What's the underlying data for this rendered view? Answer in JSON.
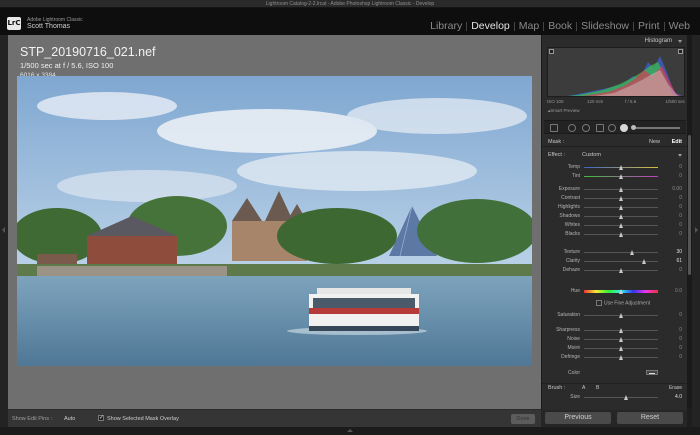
{
  "window": {
    "title": "Lightroom Catalog-2-2.lrcat - Adobe Photoshop Lightroom Classic - Develop"
  },
  "identity": {
    "logo": "LrC",
    "app_name": "Adobe Lightroom Classic",
    "user_name": "Scott Thomas"
  },
  "modules": [
    {
      "label": "Library",
      "active": false
    },
    {
      "label": "Develop",
      "active": true
    },
    {
      "label": "Map",
      "active": false
    },
    {
      "label": "Book",
      "active": false
    },
    {
      "label": "Slideshow",
      "active": false
    },
    {
      "label": "Print",
      "active": false
    },
    {
      "label": "Web",
      "active": false
    }
  ],
  "image_info": {
    "file_name": "STP_20190716_021.nef",
    "exif": "1/500 sec at f / 5.6, ISO 100",
    "dimensions": "6016 x 3384"
  },
  "toolbar": {
    "edit_pins_label": "Show Edit Pins :",
    "edit_pins_value": "Auto",
    "overlay_label": "Show Selected Mask Overlay",
    "done_label": "Done"
  },
  "histogram": {
    "label": "Histogram",
    "iso": "ISO 100",
    "focal": "120 mm",
    "aperture": "f / 5.6",
    "shutter": "1/500 sec",
    "smart_preview": "Smart Preview"
  },
  "mask": {
    "label": "Mask :",
    "new_label": "New",
    "edit_label": "Edit"
  },
  "effect": {
    "label": "Effect :",
    "value": "Custom"
  },
  "sliders": {
    "temp": {
      "label": "Temp",
      "value": "0"
    },
    "tint": {
      "label": "Tint",
      "value": "0"
    },
    "exposure": {
      "label": "Exposure",
      "value": "0.00"
    },
    "contrast": {
      "label": "Contrast",
      "value": "0"
    },
    "highlights": {
      "label": "Highlights",
      "value": "0"
    },
    "shadows": {
      "label": "Shadows",
      "value": "0"
    },
    "whites": {
      "label": "Whites",
      "value": "0"
    },
    "blacks": {
      "label": "Blacks",
      "value": "0"
    },
    "texture": {
      "label": "Texture",
      "value": "30"
    },
    "clarity": {
      "label": "Clarity",
      "value": "61"
    },
    "dehaze": {
      "label": "Dehaze",
      "value": "0"
    },
    "hue": {
      "label": "Hue",
      "value": "0.0"
    },
    "saturation": {
      "label": "Saturation",
      "value": "0"
    },
    "sharpness": {
      "label": "Sharpness",
      "value": "0"
    },
    "noise": {
      "label": "Noise",
      "value": "0"
    },
    "moire": {
      "label": "Moiré",
      "value": "0"
    },
    "defringe": {
      "label": "Defringe",
      "value": "0"
    },
    "size": {
      "label": "Size",
      "value": "4.0"
    }
  },
  "fine_adjustment": "Use Fine Adjustment",
  "color_label": "Color",
  "brush": {
    "label": "Brush :",
    "a": "A",
    "b": "B",
    "erase": "Erase"
  },
  "buttons": {
    "previous": "Previous",
    "reset": "Reset"
  }
}
